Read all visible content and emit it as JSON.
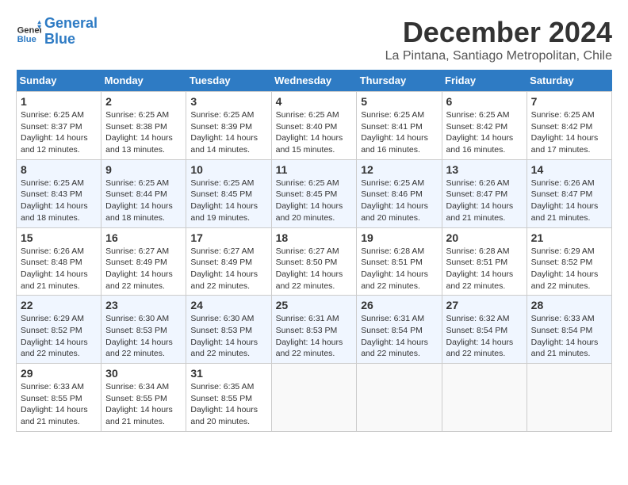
{
  "header": {
    "logo_line1": "General",
    "logo_line2": "Blue",
    "month_year": "December 2024",
    "location": "La Pintana, Santiago Metropolitan, Chile"
  },
  "days_of_week": [
    "Sunday",
    "Monday",
    "Tuesday",
    "Wednesday",
    "Thursday",
    "Friday",
    "Saturday"
  ],
  "weeks": [
    [
      {
        "day": "1",
        "sunrise": "6:25 AM",
        "sunset": "8:37 PM",
        "daylight": "14 hours and 12 minutes."
      },
      {
        "day": "2",
        "sunrise": "6:25 AM",
        "sunset": "8:38 PM",
        "daylight": "14 hours and 13 minutes."
      },
      {
        "day": "3",
        "sunrise": "6:25 AM",
        "sunset": "8:39 PM",
        "daylight": "14 hours and 14 minutes."
      },
      {
        "day": "4",
        "sunrise": "6:25 AM",
        "sunset": "8:40 PM",
        "daylight": "14 hours and 15 minutes."
      },
      {
        "day": "5",
        "sunrise": "6:25 AM",
        "sunset": "8:41 PM",
        "daylight": "14 hours and 16 minutes."
      },
      {
        "day": "6",
        "sunrise": "6:25 AM",
        "sunset": "8:42 PM",
        "daylight": "14 hours and 16 minutes."
      },
      {
        "day": "7",
        "sunrise": "6:25 AM",
        "sunset": "8:42 PM",
        "daylight": "14 hours and 17 minutes."
      }
    ],
    [
      {
        "day": "8",
        "sunrise": "6:25 AM",
        "sunset": "8:43 PM",
        "daylight": "14 hours and 18 minutes."
      },
      {
        "day": "9",
        "sunrise": "6:25 AM",
        "sunset": "8:44 PM",
        "daylight": "14 hours and 18 minutes."
      },
      {
        "day": "10",
        "sunrise": "6:25 AM",
        "sunset": "8:45 PM",
        "daylight": "14 hours and 19 minutes."
      },
      {
        "day": "11",
        "sunrise": "6:25 AM",
        "sunset": "8:45 PM",
        "daylight": "14 hours and 20 minutes."
      },
      {
        "day": "12",
        "sunrise": "6:25 AM",
        "sunset": "8:46 PM",
        "daylight": "14 hours and 20 minutes."
      },
      {
        "day": "13",
        "sunrise": "6:26 AM",
        "sunset": "8:47 PM",
        "daylight": "14 hours and 21 minutes."
      },
      {
        "day": "14",
        "sunrise": "6:26 AM",
        "sunset": "8:47 PM",
        "daylight": "14 hours and 21 minutes."
      }
    ],
    [
      {
        "day": "15",
        "sunrise": "6:26 AM",
        "sunset": "8:48 PM",
        "daylight": "14 hours and 21 minutes."
      },
      {
        "day": "16",
        "sunrise": "6:27 AM",
        "sunset": "8:49 PM",
        "daylight": "14 hours and 22 minutes."
      },
      {
        "day": "17",
        "sunrise": "6:27 AM",
        "sunset": "8:49 PM",
        "daylight": "14 hours and 22 minutes."
      },
      {
        "day": "18",
        "sunrise": "6:27 AM",
        "sunset": "8:50 PM",
        "daylight": "14 hours and 22 minutes."
      },
      {
        "day": "19",
        "sunrise": "6:28 AM",
        "sunset": "8:51 PM",
        "daylight": "14 hours and 22 minutes."
      },
      {
        "day": "20",
        "sunrise": "6:28 AM",
        "sunset": "8:51 PM",
        "daylight": "14 hours and 22 minutes."
      },
      {
        "day": "21",
        "sunrise": "6:29 AM",
        "sunset": "8:52 PM",
        "daylight": "14 hours and 22 minutes."
      }
    ],
    [
      {
        "day": "22",
        "sunrise": "6:29 AM",
        "sunset": "8:52 PM",
        "daylight": "14 hours and 22 minutes."
      },
      {
        "day": "23",
        "sunrise": "6:30 AM",
        "sunset": "8:53 PM",
        "daylight": "14 hours and 22 minutes."
      },
      {
        "day": "24",
        "sunrise": "6:30 AM",
        "sunset": "8:53 PM",
        "daylight": "14 hours and 22 minutes."
      },
      {
        "day": "25",
        "sunrise": "6:31 AM",
        "sunset": "8:53 PM",
        "daylight": "14 hours and 22 minutes."
      },
      {
        "day": "26",
        "sunrise": "6:31 AM",
        "sunset": "8:54 PM",
        "daylight": "14 hours and 22 minutes."
      },
      {
        "day": "27",
        "sunrise": "6:32 AM",
        "sunset": "8:54 PM",
        "daylight": "14 hours and 22 minutes."
      },
      {
        "day": "28",
        "sunrise": "6:33 AM",
        "sunset": "8:54 PM",
        "daylight": "14 hours and 21 minutes."
      }
    ],
    [
      {
        "day": "29",
        "sunrise": "6:33 AM",
        "sunset": "8:55 PM",
        "daylight": "14 hours and 21 minutes."
      },
      {
        "day": "30",
        "sunrise": "6:34 AM",
        "sunset": "8:55 PM",
        "daylight": "14 hours and 21 minutes."
      },
      {
        "day": "31",
        "sunrise": "6:35 AM",
        "sunset": "8:55 PM",
        "daylight": "14 hours and 20 minutes."
      },
      null,
      null,
      null,
      null
    ]
  ]
}
